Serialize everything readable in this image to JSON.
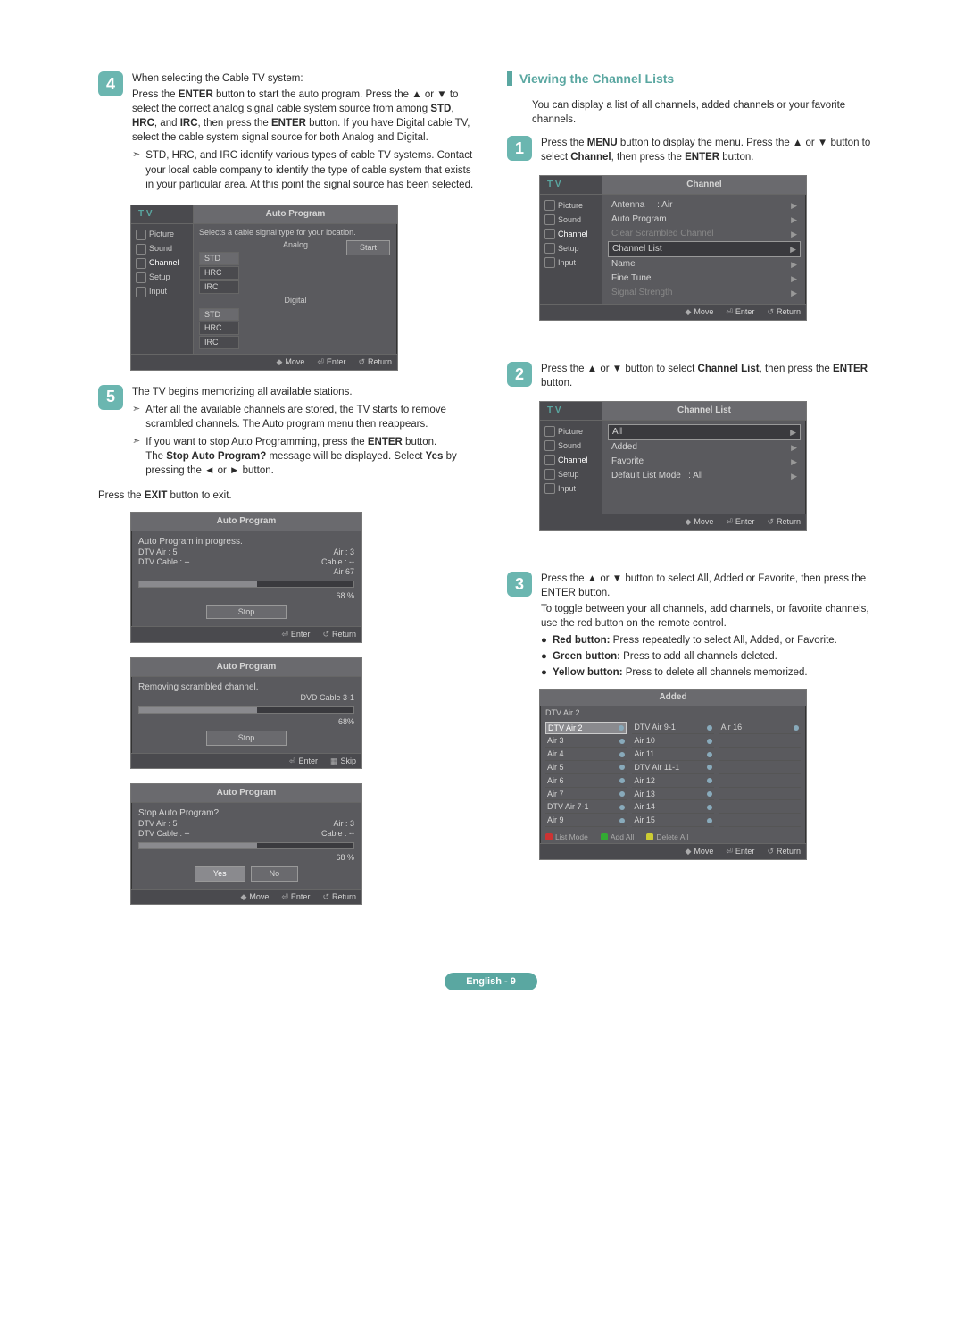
{
  "left": {
    "step4": {
      "num": "4",
      "l1_a": "When selecting the Cable TV system:",
      "l1_b": "Press the ",
      "l1_c": "ENTER",
      "l1_d": " button to start the auto program.",
      "l2": "Press the ▲ or ▼ to select the correct analog signal cable system source from among ",
      "std": "STD",
      "hrc": "HRC",
      "and": ", and ",
      "irc": "IRC",
      "l3": ", then press the ",
      "enter2": "ENTER",
      "l4": " button. If you have Digital cable TV, select the cable system signal source for both Analog and Digital.",
      "note": "STD, HRC, and IRC identify various types of cable TV systems. Contact your local cable company to identify the type of cable system that exists in your particular area. At this point the signal source has been selected."
    },
    "osd_auto": {
      "tv": "T V",
      "title": "Auto Program",
      "hint": "Selects a cable signal type for your location.",
      "analog": "Analog",
      "std": "STD",
      "hrc": "HRC",
      "irc": "IRC",
      "digital": "Digital",
      "start": "Start",
      "side": [
        "Picture",
        "Sound",
        "Channel",
        "Setup",
        "Input"
      ],
      "foot_move": "Move",
      "foot_enter": "Enter",
      "foot_return": "Return"
    },
    "step5": {
      "num": "5",
      "intro": "The TV begins memorizing all available stations.",
      "a": "After all the available channels are stored, the TV starts to remove scrambled channels. The Auto program menu then reappears.",
      "b1": "If you want to stop Auto Programming, press the ",
      "b_enter": "ENTER",
      "b2": " button.",
      "b3a": "The ",
      "b3b": "Stop Auto Program?",
      "b3c": " message will be displayed. Select ",
      "b3d": "Yes",
      "b3e": " by pressing the ◄ or ► button.",
      "exit_a": "Press the ",
      "exit_b": "EXIT",
      "exit_c": " button to exit."
    },
    "osd_prog1": {
      "title": "Auto Program",
      "l1": "Auto Program in progress.",
      "l2a": "DTV Air : 5",
      "l2b": "Air : 3",
      "l3a": "DTV Cable : --",
      "l3b": "Cable : --",
      "air67": "Air 67",
      "pct": "68 %",
      "stop": "Stop",
      "foot_enter": "Enter",
      "foot_return": "Return"
    },
    "osd_prog2": {
      "title": "Auto Program",
      "l1": "Removing scrambled channel.",
      "dvd": "DVD Cable 3-1",
      "pct": "68%",
      "stop": "Stop",
      "foot_enter": "Enter",
      "foot_skip": "Skip"
    },
    "osd_prog3": {
      "title": "Auto Program",
      "l1": "Stop Auto Program?",
      "l2a": "DTV Air : 5",
      "l2b": "Air : 3",
      "l3a": "DTV Cable : --",
      "l3b": "Cable : --",
      "pct": "68 %",
      "yes": "Yes",
      "no": "No",
      "foot_move": "Move",
      "foot_enter": "Enter",
      "foot_return": "Return"
    }
  },
  "right": {
    "heading": "Viewing the Channel Lists",
    "intro": "You can display a list of all channels, added channels or your favorite channels.",
    "step1": {
      "num": "1",
      "a": "Press the ",
      "menu": "MENU",
      "b": " button to display the menu.",
      "c": "Press the ▲ or ▼ button to select ",
      "channel": "Channel",
      "d": ", then press the ",
      "enter": "ENTER",
      "e": " button."
    },
    "osd_channel": {
      "tv": "T V",
      "title": "Channel",
      "r1a": "Antenna",
      "r1b": ": Air",
      "r2": "Auto Program",
      "r3": "Clear Scrambled Channel",
      "r4": "Channel List",
      "r5": "Name",
      "r6": "Fine Tune",
      "r7": "Signal Strength",
      "side": [
        "Picture",
        "Sound",
        "Channel",
        "Setup",
        "Input"
      ],
      "foot_move": "Move",
      "foot_enter": "Enter",
      "foot_return": "Return"
    },
    "step2": {
      "num": "2",
      "a": "Press the ▲ or ▼ button to select ",
      "cl": "Channel List",
      "b": ", then press the ",
      "enter": "ENTER",
      "c": " button."
    },
    "osd_chlist": {
      "tv": "T V",
      "title": "Channel List",
      "r1": "All",
      "r2": "Added",
      "r3": "Favorite",
      "r4a": "Default List Mode",
      "r4b": ": All",
      "side": [
        "Picture",
        "Sound",
        "Channel",
        "Setup",
        "Input"
      ],
      "foot_move": "Move",
      "foot_enter": "Enter",
      "foot_return": "Return"
    },
    "step3": {
      "num": "3",
      "a": "Press the ▲ or ▼ button to select All, Added or Favorite, then press the ENTER button.",
      "b": "To toggle between your all channels, add channels, or favorite channels, use the red button on the remote control.",
      "red_a": "Red button:",
      "red_b": " Press repeatedly to select All, Added, or Favorite.",
      "grn_a": "Green button:",
      "grn_b": " Press to add all channels deleted.",
      "yel_a": "Yellow button:",
      "yel_b": " Press to delete all channels memorized."
    },
    "osd_added": {
      "title": "Added",
      "intro": "DTV Air 2",
      "col1": [
        "DTV Air 2",
        "Air 3",
        "Air 4",
        "Air 5",
        "Air 6",
        "Air 7",
        "DTV Air 7-1",
        "Air 9"
      ],
      "col2": [
        "DTV Air 9-1",
        "Air 10",
        "Air 11",
        "DTV Air 11-1",
        "Air 12",
        "Air 13",
        "Air 14",
        "Air 15"
      ],
      "col3": [
        "Air 16",
        "",
        "",
        "",
        "",
        "",
        "",
        ""
      ],
      "leg_list": "List Mode",
      "leg_add": "Add All",
      "leg_del": "Delete All",
      "foot_move": "Move",
      "foot_enter": "Enter",
      "foot_return": "Return"
    }
  },
  "footer": "English - 9"
}
